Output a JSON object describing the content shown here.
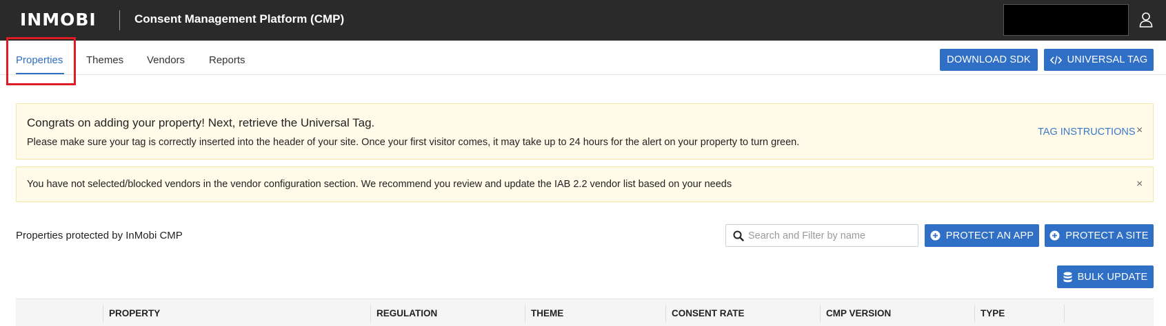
{
  "header": {
    "logo_text": "INMOBI",
    "app_title": "Consent Management Platform (CMP)"
  },
  "tabs": [
    {
      "label": "Properties",
      "active": true
    },
    {
      "label": "Themes",
      "active": false
    },
    {
      "label": "Vendors",
      "active": false
    },
    {
      "label": "Reports",
      "active": false
    }
  ],
  "toolbar": {
    "download_sdk": "DOWNLOAD SDK",
    "universal_tag": "UNIVERSAL TAG"
  },
  "alerts": {
    "tag": {
      "title": "Congrats on adding your property! Next, retrieve the Universal Tag.",
      "text": "Please make sure your tag is correctly inserted into the header of your site. Once your first visitor comes, it may take up to 24 hours for the alert on your property to turn green.",
      "link": "TAG INSTRUCTIONS",
      "close": "×"
    },
    "vendors": {
      "text": "You have not selected/blocked vendors in the vendor configuration section. We recommend you review and update the IAB 2.2 vendor list based on your needs",
      "close": "×"
    }
  },
  "properties": {
    "label": "Properties protected by InMobi CMP",
    "search_placeholder": "Search and Filter by name",
    "protect_app": "PROTECT AN APP",
    "protect_site": "PROTECT A SITE",
    "bulk_update": "BULK UPDATE"
  },
  "table": {
    "columns": [
      "PROPERTY",
      "REGULATION",
      "THEME",
      "CONSENT RATE",
      "CMP VERSION",
      "TYPE"
    ]
  },
  "colors": {
    "primary": "#2f6fc6",
    "topbar": "#2a2a2a",
    "alert_bg": "#fffbe8",
    "highlight": "#e01b24"
  },
  "icons": {
    "user": "user-icon",
    "code": "code-icon",
    "plus_circle": "plus-circle-icon",
    "search": "search-icon",
    "database": "database-icon",
    "close": "close-icon"
  }
}
